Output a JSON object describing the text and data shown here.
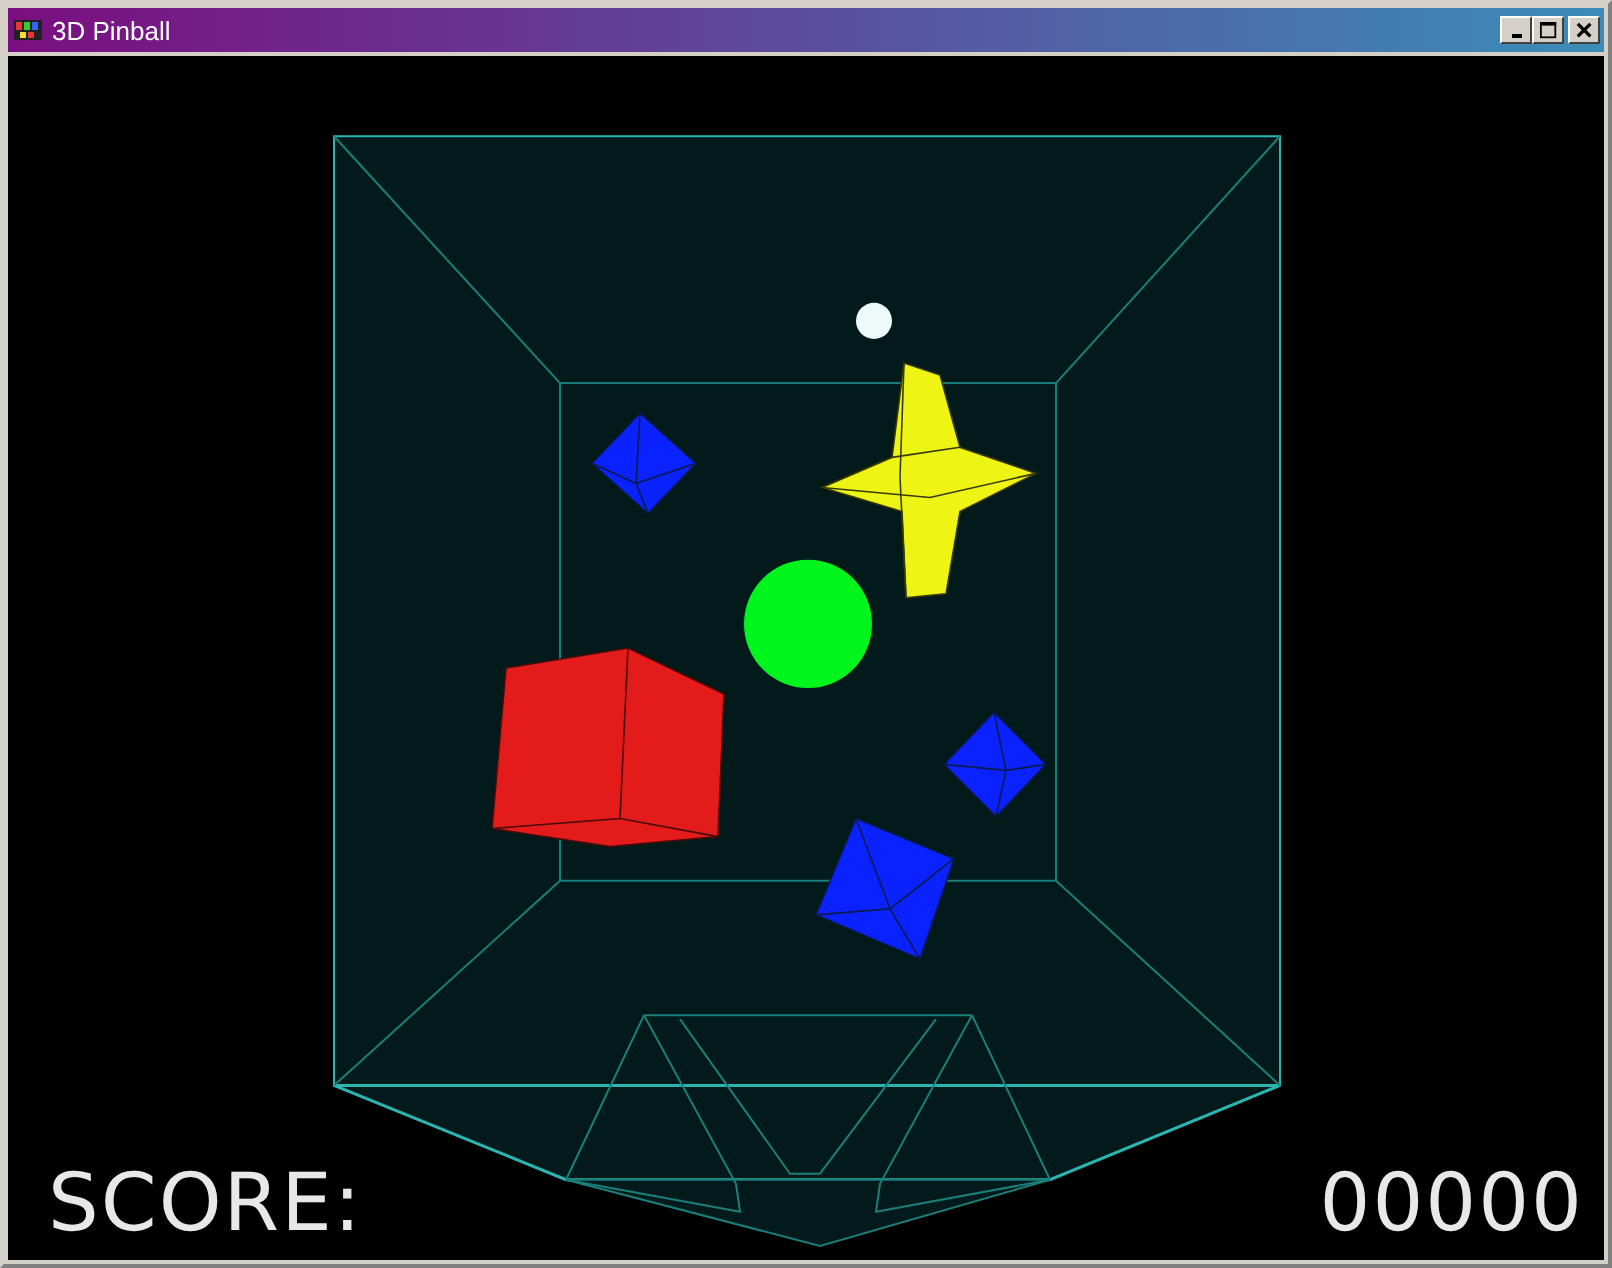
{
  "window": {
    "title": "3D Pinball"
  },
  "score": {
    "label": "SCORE:",
    "value": "00000"
  }
}
